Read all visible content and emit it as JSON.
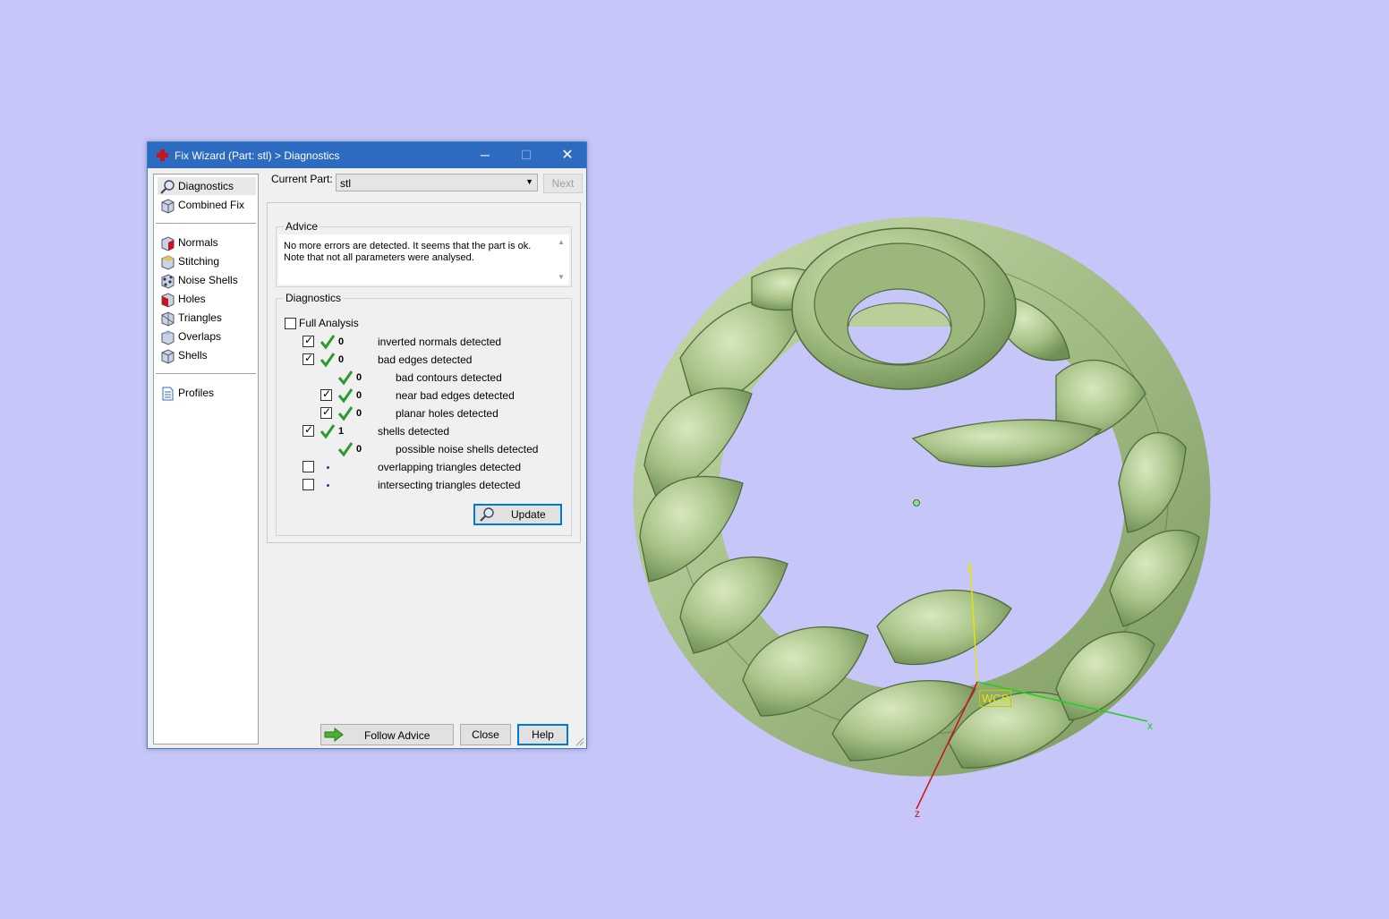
{
  "dialog": {
    "title": "Fix Wizard (Part: stl) > Diagnostics",
    "controls": {
      "minimize": "─",
      "maximize": "☐",
      "close": "✕"
    }
  },
  "sidebar": {
    "items": [
      {
        "label": "Diagnostics",
        "icon": "magnifier-icon",
        "active": true
      },
      {
        "label": "Combined Fix",
        "icon": "cube-icon"
      },
      {
        "label": "Normals",
        "icon": "normals-cube-icon"
      },
      {
        "label": "Stitching",
        "icon": "stitching-cube-icon"
      },
      {
        "label": "Noise Shells",
        "icon": "noise-shells-icon"
      },
      {
        "label": "Holes",
        "icon": "holes-cube-icon"
      },
      {
        "label": "Triangles",
        "icon": "triangles-cube-icon"
      },
      {
        "label": "Overlaps",
        "icon": "overlaps-cube-icon"
      },
      {
        "label": "Shells",
        "icon": "shells-cube-icon"
      },
      {
        "label": "Profiles",
        "icon": "document-icon"
      }
    ]
  },
  "current_part": {
    "label": "Current Part:",
    "value": "stl",
    "next_label": "Next"
  },
  "advice": {
    "title": "Advice",
    "text": "No more errors are detected. It seems that the part is ok. Note that not all parameters were analysed."
  },
  "diagnostics": {
    "title": "Diagnostics",
    "full_analysis": {
      "label": "Full Analysis",
      "checked": false
    },
    "rows": [
      {
        "count": "0",
        "label": "inverted normals detected",
        "checked": true,
        "ok": true
      },
      {
        "count": "0",
        "label": "bad edges detected",
        "checked": true,
        "ok": true
      },
      {
        "count": "0",
        "label": "bad contours detected",
        "checked": null,
        "ok": true
      },
      {
        "count": "0",
        "label": "near bad edges detected",
        "checked": true,
        "ok": true
      },
      {
        "count": "0",
        "label": "planar holes detected",
        "checked": true,
        "ok": true
      },
      {
        "count": "1",
        "label": "shells detected",
        "checked": true,
        "ok": true
      },
      {
        "count": "0",
        "label": "possible noise shells detected",
        "checked": null,
        "ok": true
      },
      {
        "count": "",
        "label": "overlapping triangles detected",
        "checked": false,
        "ok": null
      },
      {
        "count": "",
        "label": "intersecting triangles detected",
        "checked": false,
        "ok": null
      }
    ],
    "update_label": "Update"
  },
  "footer": {
    "follow_advice": "Follow Advice",
    "close": "Close",
    "help": "Help"
  },
  "viewport": {
    "background": "#c6c6f9",
    "model_color": "#a9c38a",
    "wcs_label": "WCS",
    "axes": {
      "x": "x",
      "y": "y",
      "z": "z"
    }
  }
}
